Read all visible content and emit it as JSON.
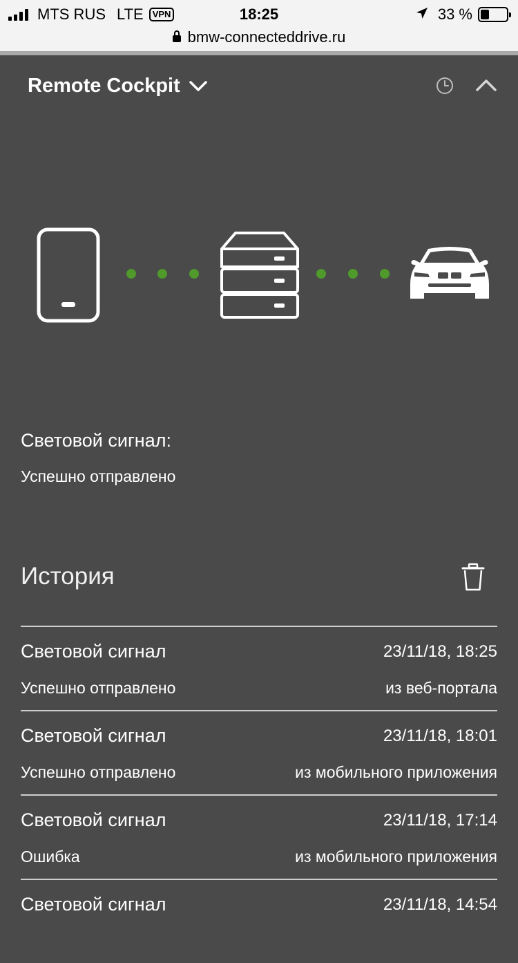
{
  "status_bar": {
    "carrier": "MTS RUS",
    "network": "LTE",
    "vpn": "VPN",
    "time": "18:25",
    "battery": "33 %",
    "battery_level": 0.33
  },
  "browser": {
    "url": "bmw-connecteddrive.ru"
  },
  "header": {
    "title": "Remote Cockpit"
  },
  "diagram": {
    "dot_color": "#4f9a2b"
  },
  "current_status": {
    "label": "Световой сигнал:",
    "value": "Успешно отправлено"
  },
  "history": {
    "title": "История",
    "items": [
      {
        "name": "Световой сигнал",
        "date": "23/11/18, 18:25",
        "status": "Успешно отправлено",
        "source": "из веб-портала"
      },
      {
        "name": "Световой сигнал",
        "date": "23/11/18, 18:01",
        "status": "Успешно отправлено",
        "source": "из мобильного приложения"
      },
      {
        "name": "Световой сигнал",
        "date": "23/11/18, 17:14",
        "status": "Ошибка",
        "source": "из мобильного приложения"
      },
      {
        "name": "Световой сигнал",
        "date": "23/11/18, 14:54",
        "status": "",
        "source": ""
      }
    ]
  }
}
